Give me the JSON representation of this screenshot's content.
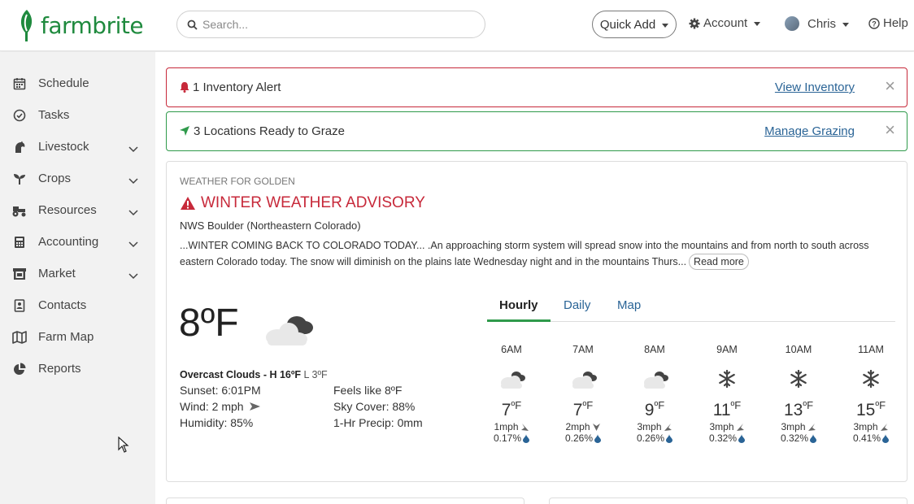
{
  "brand": {
    "name": "farmbrite",
    "color": "#1f8a3e"
  },
  "header": {
    "search_placeholder": "Search...",
    "quick_add": "Quick Add",
    "account": "Account",
    "user": "Chris",
    "help": "Help"
  },
  "sidebar": {
    "items": [
      {
        "label": "Schedule",
        "icon": "calendar-icon"
      },
      {
        "label": "Tasks",
        "icon": "check-circle-icon"
      },
      {
        "label": "Livestock",
        "icon": "horse-icon",
        "expandable": true
      },
      {
        "label": "Crops",
        "icon": "seedling-icon",
        "expandable": true
      },
      {
        "label": "Resources",
        "icon": "tractor-icon",
        "expandable": true
      },
      {
        "label": "Accounting",
        "icon": "calculator-icon",
        "expandable": true
      },
      {
        "label": "Market",
        "icon": "store-icon",
        "expandable": true
      },
      {
        "label": "Contacts",
        "icon": "address-book-icon"
      },
      {
        "label": "Farm Map",
        "icon": "map-icon"
      },
      {
        "label": "Reports",
        "icon": "pie-chart-icon"
      }
    ]
  },
  "alerts": [
    {
      "text": "1 Inventory Alert",
      "link": "View Inventory",
      "close": "×",
      "icon": "bell-icon",
      "color": "#c7293a"
    },
    {
      "text": "3 Locations Ready to Graze",
      "link": "Manage Grazing",
      "close": "×",
      "icon": "location-arrow-icon",
      "color": "#2f9a4b"
    }
  ],
  "weather": {
    "location_label": "WEATHER FOR GOLDEN",
    "advisory_title": "WINTER WEATHER ADVISORY",
    "advisory_source": "NWS Boulder (Northeastern Colorado)",
    "advisory_text": "...WINTER COMING BACK TO COLORADO TODAY... .An approaching storm system will spread snow into the mountains and from north to south across eastern Colorado today. The snow will diminish on the plains late Wednesday night and in the mountains Thurs...",
    "read_more": "Read more",
    "current_temp": "8ºF",
    "condition": "Overcast Clouds - H ",
    "high": "16ºF",
    "low": " L 3ºF",
    "sunset": "Sunset: 6:01PM",
    "wind": "Wind: 2 mph",
    "humidity": "Humidity: 85%",
    "feels_like": "Feels like 8ºF",
    "sky_cover": "Sky Cover: 88%",
    "precip": "1-Hr Precip: 0mm",
    "tabs": [
      "Hourly",
      "Daily",
      "Map"
    ],
    "active_tab": "Hourly",
    "hourly": [
      {
        "time": "6AM",
        "temp": "7",
        "unit": "ºF",
        "wind": "1mph",
        "precip": "0.17%",
        "icon": "cloudy-icon"
      },
      {
        "time": "7AM",
        "temp": "7",
        "unit": "ºF",
        "wind": "2mph",
        "precip": "0.26%",
        "icon": "cloudy-icon"
      },
      {
        "time": "8AM",
        "temp": "9",
        "unit": "ºF",
        "wind": "3mph",
        "precip": "0.26%",
        "icon": "cloudy-icon"
      },
      {
        "time": "9AM",
        "temp": "11",
        "unit": "ºF",
        "wind": "3mph",
        "precip": "0.32%",
        "icon": "snowflake-icon"
      },
      {
        "time": "10AM",
        "temp": "13",
        "unit": "ºF",
        "wind": "3mph",
        "precip": "0.32%",
        "icon": "snowflake-icon"
      },
      {
        "time": "11AM",
        "temp": "15",
        "unit": "ºF",
        "wind": "3mph",
        "precip": "0.41%",
        "icon": "snowflake-icon"
      }
    ]
  }
}
